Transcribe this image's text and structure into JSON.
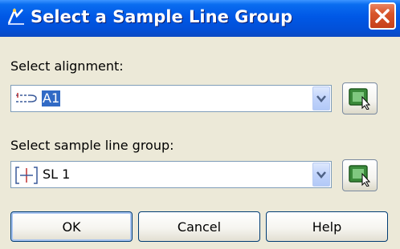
{
  "window": {
    "title": "Select a Sample Line Group"
  },
  "alignment": {
    "label": "Select alignment:",
    "value": "A1"
  },
  "sample_line_group": {
    "label": "Select sample line group:",
    "value": "SL 1"
  },
  "buttons": {
    "ok": "OK",
    "cancel": "Cancel",
    "help": "Help"
  },
  "icons": {
    "app": "civil3d-app-icon",
    "close": "close-icon",
    "alignment": "alignment-icon",
    "sample_line_group": "sample-line-group-icon",
    "dropdown": "chevron-down-icon",
    "pick": "pick-from-drawing-icon"
  },
  "colors": {
    "titlebar": "#0058e6",
    "close_button": "#d8552a",
    "dialog_bg": "#ece9d8",
    "selection": "#316ac5",
    "field_border": "#7f9db9"
  }
}
